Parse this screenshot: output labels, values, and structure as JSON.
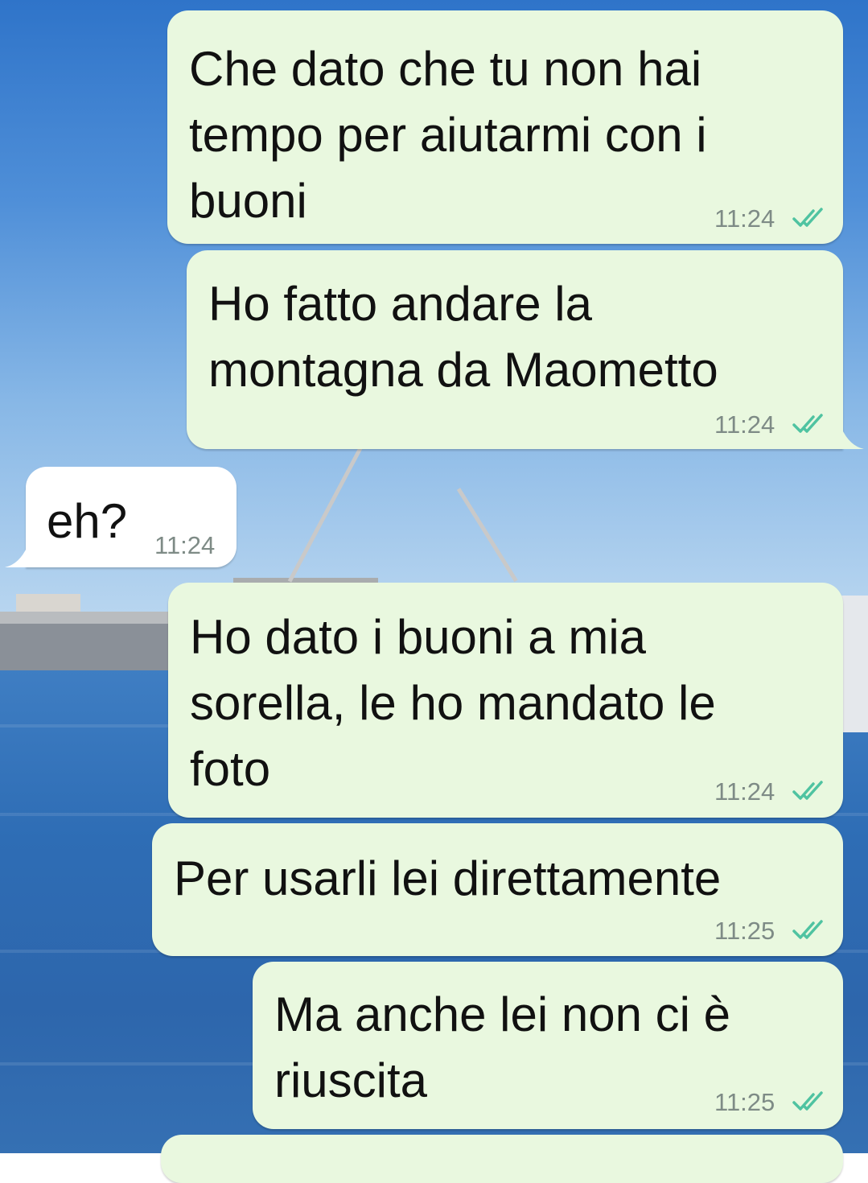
{
  "colors": {
    "outgoing_bubble": "#e9f8df",
    "incoming_bubble": "#ffffff",
    "read_ticks": "#4fc3a1",
    "time_text": "#7e8b86"
  },
  "icons": {
    "read_receipt": "double-check-icon"
  },
  "messages": [
    {
      "direction": "out",
      "text": "Che dato che tu non hai\ntempo per aiutarmi con i\nbuoni",
      "time": "11:24",
      "status": "read"
    },
    {
      "direction": "out",
      "text": "Ho fatto andare la\nmontagna da Maometto",
      "time": "11:24",
      "status": "read"
    },
    {
      "direction": "in",
      "text": "eh?",
      "time": "11:24"
    },
    {
      "direction": "out",
      "text": "Ho dato i buoni a mia\nsorella, le ho mandato le\nfoto",
      "time": "11:24",
      "status": "read"
    },
    {
      "direction": "out",
      "text": "Per usarli lei direttamente",
      "time": "11:25",
      "status": "read"
    },
    {
      "direction": "out",
      "text": "Ma anche lei non ci è\nriuscita",
      "time": "11:25",
      "status": "read"
    }
  ]
}
